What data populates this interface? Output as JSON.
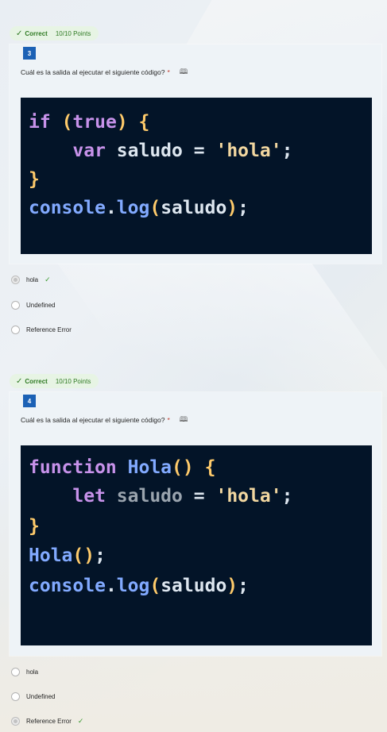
{
  "questions": [
    {
      "status": "Correct",
      "points": "10/10 Points",
      "number": "3",
      "text": "Cuál es la salida al ejecutar el siguiente código?",
      "required_mark": "*",
      "reader_icon": "immersive-reader-icon",
      "code_lines": [
        "if (true) {",
        "    var saludo = 'hola';",
        "}",
        "console.log(saludo);"
      ],
      "options": [
        {
          "label": "hola",
          "selected": true,
          "correct": true
        },
        {
          "label": "Undefined",
          "selected": false,
          "correct": false
        },
        {
          "label": "Reference Error",
          "selected": false,
          "correct": false
        }
      ]
    },
    {
      "status": "Correct",
      "points": "10/10 Points",
      "number": "4",
      "text": "Cuál es la salida al ejecutar el siguiente código?",
      "required_mark": "*",
      "reader_icon": "immersive-reader-icon",
      "code_lines": [
        "function Hola() {",
        "    let saludo = 'hola';",
        "}",
        "Hola();",
        "console.log(saludo);"
      ],
      "options": [
        {
          "label": "hola",
          "selected": false,
          "correct": false
        },
        {
          "label": "Undefined",
          "selected": false,
          "correct": false
        },
        {
          "label": "Reference Error",
          "selected": true,
          "correct": true
        }
      ]
    }
  ],
  "colors": {
    "accent": "#1c61b5",
    "correct_green": "#2f7a23",
    "code_bg": "#031428",
    "required_red": "#c0392b"
  }
}
